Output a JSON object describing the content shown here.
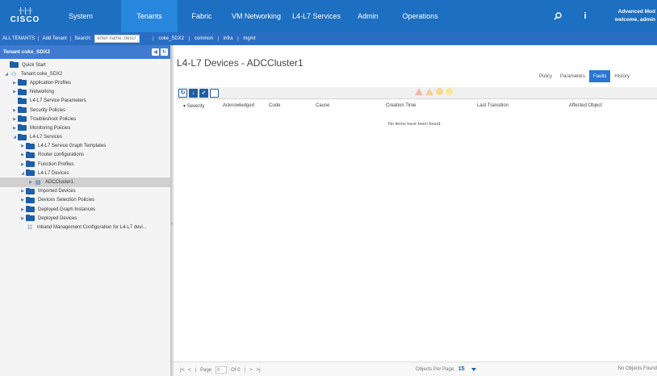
{
  "nav": {
    "logo_bars": "·|··|··|·",
    "logo_word": "CISCO",
    "tabs": [
      "System",
      "Tenants",
      "Fabric",
      "VM Networking",
      "L4-L7 Services",
      "Admin",
      "Operations"
    ],
    "active_tab": "Tenants",
    "search_icon": "search-icon",
    "info_icon": "i",
    "user_line1": "Advanced Mod",
    "user_line2": "welcome, admin"
  },
  "subbar": {
    "all_tenants": "ALL TENANTS",
    "add_tenant": "Add Tenant",
    "search_label": "Search:",
    "search_placeholder": "enter name, descr",
    "crumbs": [
      "coke_SDX2",
      "common",
      "infra",
      "mgmt"
    ]
  },
  "left": {
    "header": "Tenant coke_SDX2",
    "tree": [
      {
        "label": "Quick Start",
        "indent": 0,
        "arrow": "",
        "icon": "folder"
      },
      {
        "label": "Tenant coke_SDX2",
        "indent": 0,
        "arrow": "◢",
        "icon": "tenant"
      },
      {
        "label": "Application Profiles",
        "indent": 1,
        "arrow": "▶",
        "icon": "folder"
      },
      {
        "label": "Networking",
        "indent": 1,
        "arrow": "▶",
        "icon": "folder"
      },
      {
        "label": "L4-L7 Service Parameters",
        "indent": 1,
        "arrow": "",
        "icon": "folder"
      },
      {
        "label": "Security Policies",
        "indent": 1,
        "arrow": "▶",
        "icon": "folder"
      },
      {
        "label": "Troubleshoot Policies",
        "indent": 1,
        "arrow": "▶",
        "icon": "folder"
      },
      {
        "label": "Monitoring Policies",
        "indent": 1,
        "arrow": "▶",
        "icon": "folder"
      },
      {
        "label": "L4-L7 Services",
        "indent": 1,
        "arrow": "◢",
        "icon": "folder"
      },
      {
        "label": "L4-L7 Service Graph Templates",
        "indent": 2,
        "arrow": "▶",
        "icon": "folder"
      },
      {
        "label": "Router configurations",
        "indent": 2,
        "arrow": "▶",
        "icon": "folder"
      },
      {
        "label": "Function Profiles",
        "indent": 2,
        "arrow": "▶",
        "icon": "folder"
      },
      {
        "label": "L4-L7 Devices",
        "indent": 2,
        "arrow": "◢",
        "icon": "folder"
      },
      {
        "label": "ADCCluster1",
        "indent": 3,
        "arrow": "▶",
        "icon": "device",
        "selected": true
      },
      {
        "label": "Imported Devices",
        "indent": 2,
        "arrow": "▶",
        "icon": "folder"
      },
      {
        "label": "Devices Selection Policies",
        "indent": 2,
        "arrow": "▶",
        "icon": "folder"
      },
      {
        "label": "Deployed Graph Instances",
        "indent": 2,
        "arrow": "▶",
        "icon": "folder"
      },
      {
        "label": "Deployed Devices",
        "indent": 2,
        "arrow": "▶",
        "icon": "folder"
      },
      {
        "label": "Inband Management Configuration for L4-L7 devi...",
        "indent": 2,
        "arrow": "",
        "icon": "doc"
      }
    ]
  },
  "main": {
    "title": "L4-L7 Devices - ADCCluster1",
    "tabs": [
      "Policy",
      "Parameters",
      "Faults",
      "History"
    ],
    "active_tab": "Faults",
    "columns": [
      "Severity",
      "Acknowledged",
      "Code",
      "Cause",
      "Creation Time",
      "Last Transition",
      "Affected Object"
    ],
    "empty_message": "No items have been found.",
    "pager": {
      "page_label": "Page",
      "page_value": "0",
      "of_label": "Of 0",
      "objects_per_page_label": "Objects Per Page:",
      "objects_per_page_value": "15",
      "no_objects": "No Objects Found"
    }
  }
}
